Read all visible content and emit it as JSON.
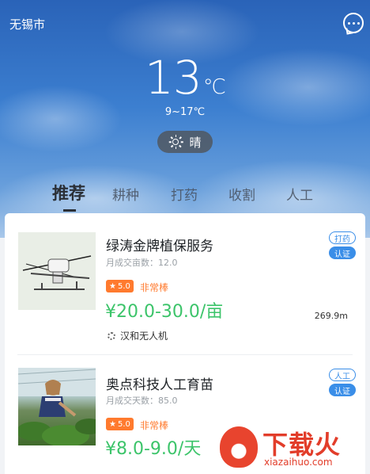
{
  "header": {
    "city": "无锡市",
    "temperature": "13",
    "unit": "℃",
    "range": "9~17℃",
    "condition": "晴"
  },
  "tabs": [
    {
      "label": "推荐",
      "active": true
    },
    {
      "label": "耕种",
      "active": false
    },
    {
      "label": "打药",
      "active": false
    },
    {
      "label": "收割",
      "active": false
    },
    {
      "label": "人工",
      "active": false
    }
  ],
  "services": [
    {
      "title": "绿涛金牌植保服务",
      "stat": "月成交亩数：12.0",
      "rating": "5.0",
      "rating_label": "非常棒",
      "price": "¥20.0-30.0/亩",
      "distance": "269.9m",
      "company": "汉和无人机",
      "tag1": "打药",
      "tag2": "认证"
    },
    {
      "title": "奥点科技人工育苗",
      "stat": "月成交天数：85.0",
      "rating": "5.0",
      "rating_label": "非常棒",
      "price": "¥8.0-9.0/天",
      "tag1": "人工",
      "tag2": "认证"
    }
  ],
  "watermark": {
    "brand": "下载火",
    "url": "xiazaihuo.com"
  },
  "colors": {
    "accent_blue": "#3a8ee8",
    "price_green": "#3cc46a",
    "rating_orange": "#ff7a2e"
  }
}
